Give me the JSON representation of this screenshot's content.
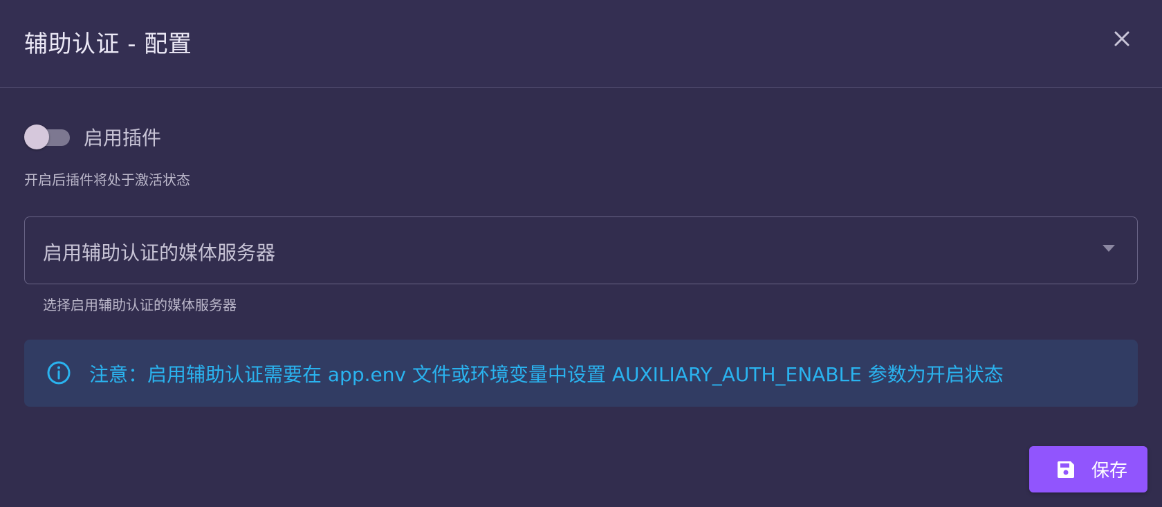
{
  "dialog": {
    "title": "辅助认证 - 配置",
    "close_icon": "close-icon"
  },
  "plugin_toggle": {
    "label": "启用插件",
    "enabled": false,
    "hint": "开启后插件将处于激活状态"
  },
  "media_server_select": {
    "placeholder": "启用辅助认证的媒体服务器",
    "hint": "选择启用辅助认证的媒体服务器",
    "caret_icon": "chevron-down-icon"
  },
  "alert": {
    "icon": "info-icon",
    "text": "注意：启用辅助认证需要在 app.env 文件或环境变量中设置 AUXILIARY_AUTH_ENABLE 参数为开启状态",
    "color": "#2ab3ef"
  },
  "footer": {
    "save_label": "保存",
    "save_icon": "save-icon"
  },
  "colors": {
    "accent": "#9155fd",
    "background": "#322d4e",
    "info": "#2ab3ef"
  }
}
